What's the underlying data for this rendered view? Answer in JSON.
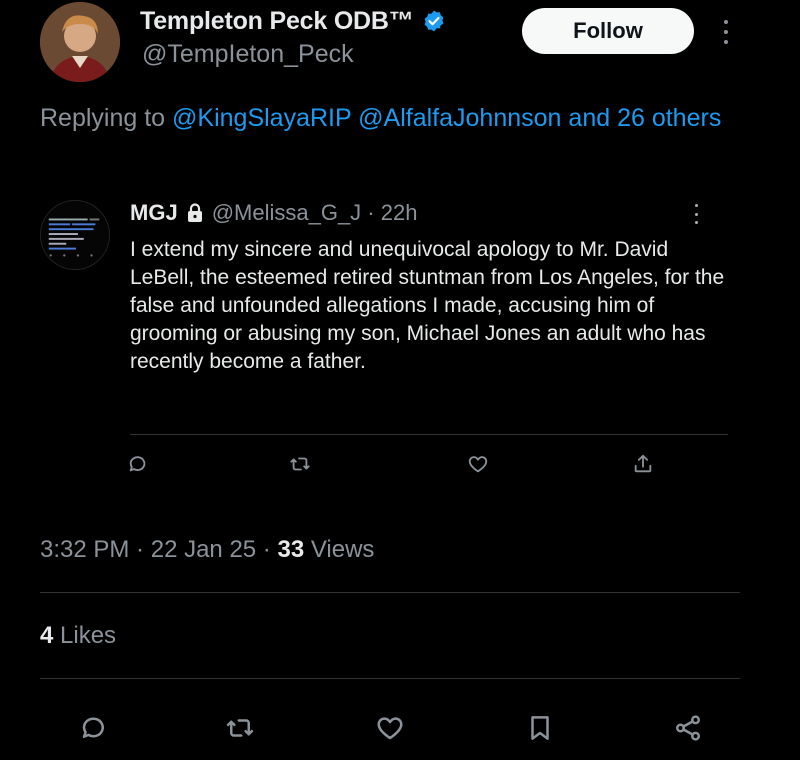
{
  "author": {
    "display_name": "Templeton Peck ODB™",
    "handle": "@TempIeton_Peck",
    "verified_icon": "verified-badge-icon",
    "avatar": "avatar"
  },
  "header": {
    "follow_label": "Follow",
    "more_icon": "more-vertical-icon"
  },
  "replying": {
    "prefix": "Replying to ",
    "mention_1": "@KingSlayaRIP",
    "mention_2": "@AlfalfaJohnnson",
    "suffix": "and 26 others"
  },
  "quoted_tweet": {
    "name": "MGJ",
    "lock_icon": "lock-icon",
    "handle_time": "@Melissa_G_J · 22h",
    "text": "I extend my sincere and unequivocal apology to Mr. David LeBell, the esteemed retired stuntman from Los Angeles, for the false and unfounded allegations I made, accusing him of grooming or abusing my son, Michael Jones an adult who has recently become a father.",
    "actions": [
      "reply-icon",
      "retweet-icon",
      "like-icon",
      "share-icon"
    ]
  },
  "meta": {
    "time": "3:32 PM",
    "sep1": " · ",
    "date": "22 Jan 25",
    "sep2": " · ",
    "views_count": "33",
    "views_label": " Views"
  },
  "likes": {
    "count": "4",
    "label": " Likes"
  },
  "bottom_actions": [
    "reply-icon",
    "retweet-icon",
    "like-icon",
    "bookmark-icon",
    "share-icon"
  ],
  "colors": {
    "background": "#000000",
    "text": "#e7e9ea",
    "muted": "#8b9299",
    "link": "#1d9bf0",
    "divider": "#2f3336",
    "follow_bg": "#f7f9f9"
  }
}
